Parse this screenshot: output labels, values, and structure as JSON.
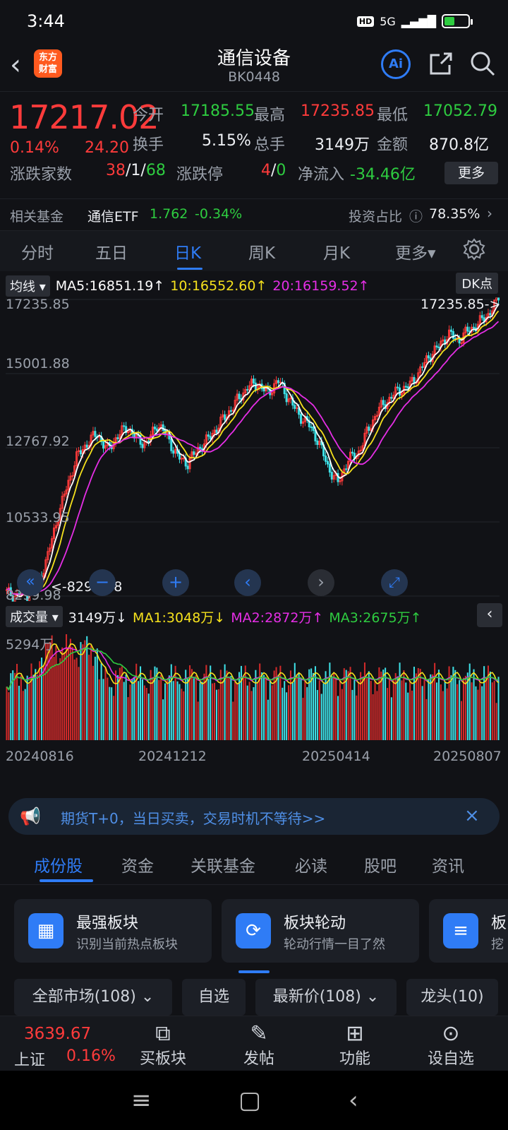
{
  "status": {
    "time": "3:44",
    "hd": "HD",
    "net": "5G",
    "signal": "▂▄▆█"
  },
  "header": {
    "title": "通信设备",
    "code": "BK0448",
    "logo_line1": "东方",
    "logo_line2": "财富",
    "ai": "Ai"
  },
  "quote": {
    "price": "17217.02",
    "pct": "0.14%",
    "change": "24.20",
    "open_label": "今开",
    "open": "17185.55",
    "high_label": "最高",
    "high": "17235.85",
    "low_label": "最低",
    "low": "17052.79",
    "turnover_label": "换手",
    "turnover": "5.15%",
    "volume_label": "总手",
    "volume": "3149万",
    "amount_label": "金额",
    "amount": "870.8亿",
    "breadth_label": "涨跌家数",
    "up": "38",
    "flat": "1",
    "down": "68",
    "sep": "/",
    "limit_label": "涨跌停",
    "limit_up": "4",
    "limit_down": "0",
    "netflow_label": "净流入",
    "netflow": "-34.46亿",
    "more": "更多",
    "fund_label": "相关基金",
    "fund_name": "通信ETF",
    "fund_price": "1.762",
    "fund_pct": "-0.34%",
    "ratio_label": "投资占比",
    "ratio": "78.35%"
  },
  "period_tabs": [
    "分时",
    "五日",
    "日K",
    "周K",
    "月K",
    "更多▾"
  ],
  "chart_head": {
    "ma_select": "均线 ▾",
    "ma5": "MA5:16851.19↑",
    "ma10": "10:16552.60↑",
    "ma20": "20:16159.52↑",
    "dk": "DK点",
    "high_tag": "17235.85->",
    "low_tag": "<-8299.98"
  },
  "chart_data": [
    {
      "type": "candlestick",
      "yticks": [
        "17235.85",
        "15001.88",
        "12767.92",
        "10533.95",
        "8299.98"
      ],
      "xticks": [
        "20240816",
        "20241212",
        "20250414",
        "20250807"
      ],
      "x_start": "20240816",
      "x_end": "20250807",
      "ylim": [
        8299.98,
        17235.85
      ],
      "close_path": [
        8400,
        8300,
        8350,
        8600,
        9400,
        10600,
        11600,
        12500,
        12900,
        13200,
        12700,
        13100,
        13400,
        13000,
        12900,
        13500,
        13100,
        12500,
        12300,
        12700,
        13000,
        13400,
        13800,
        14200,
        14600,
        14700,
        14400,
        14800,
        14300,
        13800,
        13500,
        13000,
        12200,
        11700,
        12400,
        12600,
        13300,
        13900,
        14200,
        14500,
        14600,
        15000,
        15500,
        15800,
        16200,
        16000,
        16300,
        16500,
        16800,
        17217.02
      ],
      "ma5_last": 16851.19,
      "ma10_last": 16552.6,
      "ma20_last": 16159.52
    },
    {
      "type": "bar",
      "name": "成交量",
      "ylim_max_label": "5294万",
      "current": "3149万↓",
      "ma1": "MA1:3048万↓",
      "ma2": "MA2:2872万↑",
      "ma3": "MA3:2675万↑"
    }
  ],
  "promo": {
    "text": "期货T+0，当日买卖，交易时机不等待>>"
  },
  "content_tabs": [
    "成份股",
    "资金",
    "关联基金",
    "必读",
    "股吧",
    "资讯"
  ],
  "cards": [
    {
      "title": "最强板块",
      "sub": "识别当前热点板块"
    },
    {
      "title": "板块轮动",
      "sub": "轮动行情一目了然"
    },
    {
      "title": "板",
      "sub": "挖"
    }
  ],
  "filters": [
    "全部市场(108) ⌄",
    "自选",
    "最新价(108) ⌄",
    "龙头(10)"
  ],
  "bottom_nav": {
    "index_price": "3639.67",
    "index_name": "上证",
    "index_pct": "0.16%",
    "items": [
      "买板块",
      "发帖",
      "功能",
      "设自选"
    ]
  },
  "colors": {
    "up": "#ff3b3b",
    "down": "#2ecc40",
    "accent": "#2f7cf6",
    "ma5": "#ffffff",
    "ma10": "#f5e11d",
    "ma20": "#e52ee5"
  }
}
